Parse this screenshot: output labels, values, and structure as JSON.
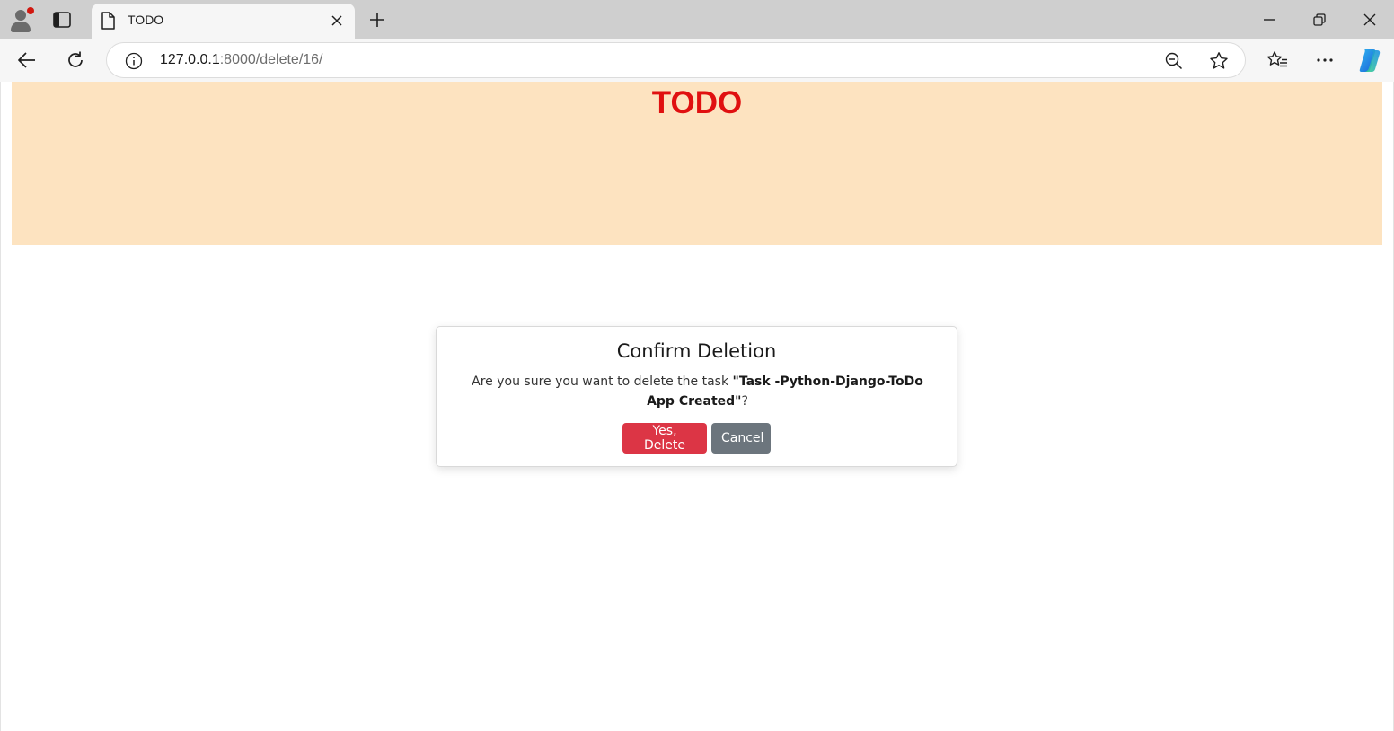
{
  "browser": {
    "tab": {
      "title": "TODO",
      "icon": "page-icon",
      "close_icon": "close-icon"
    },
    "new_tab_icon": "plus-icon",
    "window_controls": [
      "minimize-icon",
      "restore-icon",
      "close-icon"
    ],
    "address_bar": {
      "url_host": "127.0.0.1",
      "url_rest": ":8000/delete/16/",
      "info_icon": "info-icon",
      "zoom_icon": "zoom-out-icon",
      "favorite_icon": "star-icon"
    },
    "toolbar_icons": [
      "back-arrow-icon",
      "refresh-icon",
      "favorites-icon",
      "more-icon",
      "copilot-icon"
    ],
    "profile_badge_color": "#d1170f"
  },
  "page": {
    "header": {
      "title": "TODO",
      "title_color": "#e01010",
      "background": "#fde3c0"
    },
    "dialog": {
      "title": "Confirm Deletion",
      "message_prefix": "Are you sure you want to delete the task ",
      "task_name": "\"Task -Python-Django-ToDo App Created\"",
      "message_suffix": "?",
      "confirm_label": "Yes, Delete",
      "cancel_label": "Cancel",
      "confirm_color": "#dc3545",
      "cancel_color": "#6c757d"
    }
  }
}
